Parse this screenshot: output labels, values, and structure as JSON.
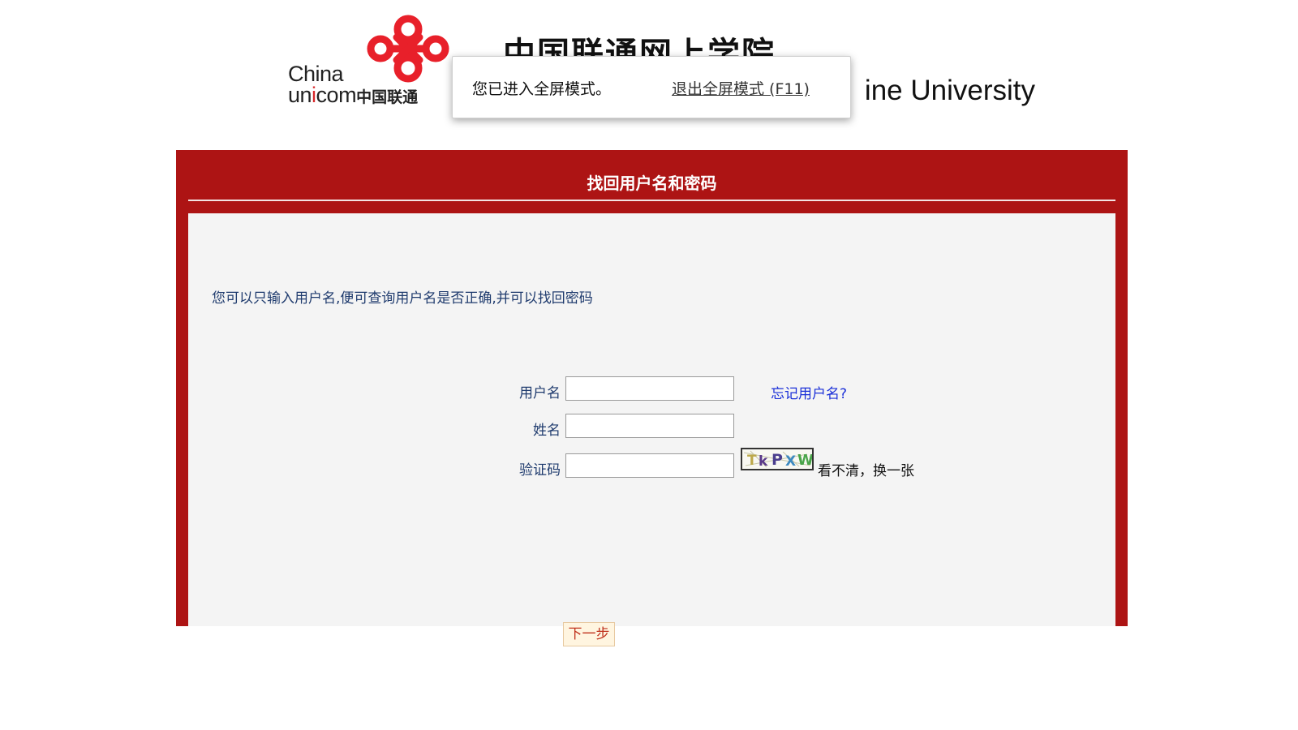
{
  "header": {
    "logo_text_line1": "China",
    "logo_text_line2_a": "un",
    "logo_text_line2_i": "i",
    "logo_text_line2_b": "com",
    "logo_text_line2_cn": "中国联通",
    "site_title_cn": "中国联通网上学院",
    "site_title_en": "ine University"
  },
  "fullscreen_notice": {
    "message": "您已进入全屏模式。",
    "exit_link": "退出全屏模式 (F11)"
  },
  "panel": {
    "title": "找回用户名和密码",
    "instruction": "您可以只输入用户名,便可查询用户名是否正确,并可以找回密码",
    "form": {
      "username_label": "用户名",
      "username_value": "",
      "forgot_username_link": "忘记用户名?",
      "name_label": "姓名",
      "name_value": "",
      "captcha_label": "验证码",
      "captcha_value": "",
      "captcha_text": "TkPXW",
      "captcha_refresh": "看不清，换一张"
    },
    "next_button": "下一步"
  },
  "colors": {
    "brand_red": "#ad1414",
    "logo_red": "#e8202a",
    "inner_bg": "#f4f4f4",
    "label_blue": "#1f3b6e",
    "link_blue": "#1a2fd8",
    "button_text": "#c0331e"
  }
}
